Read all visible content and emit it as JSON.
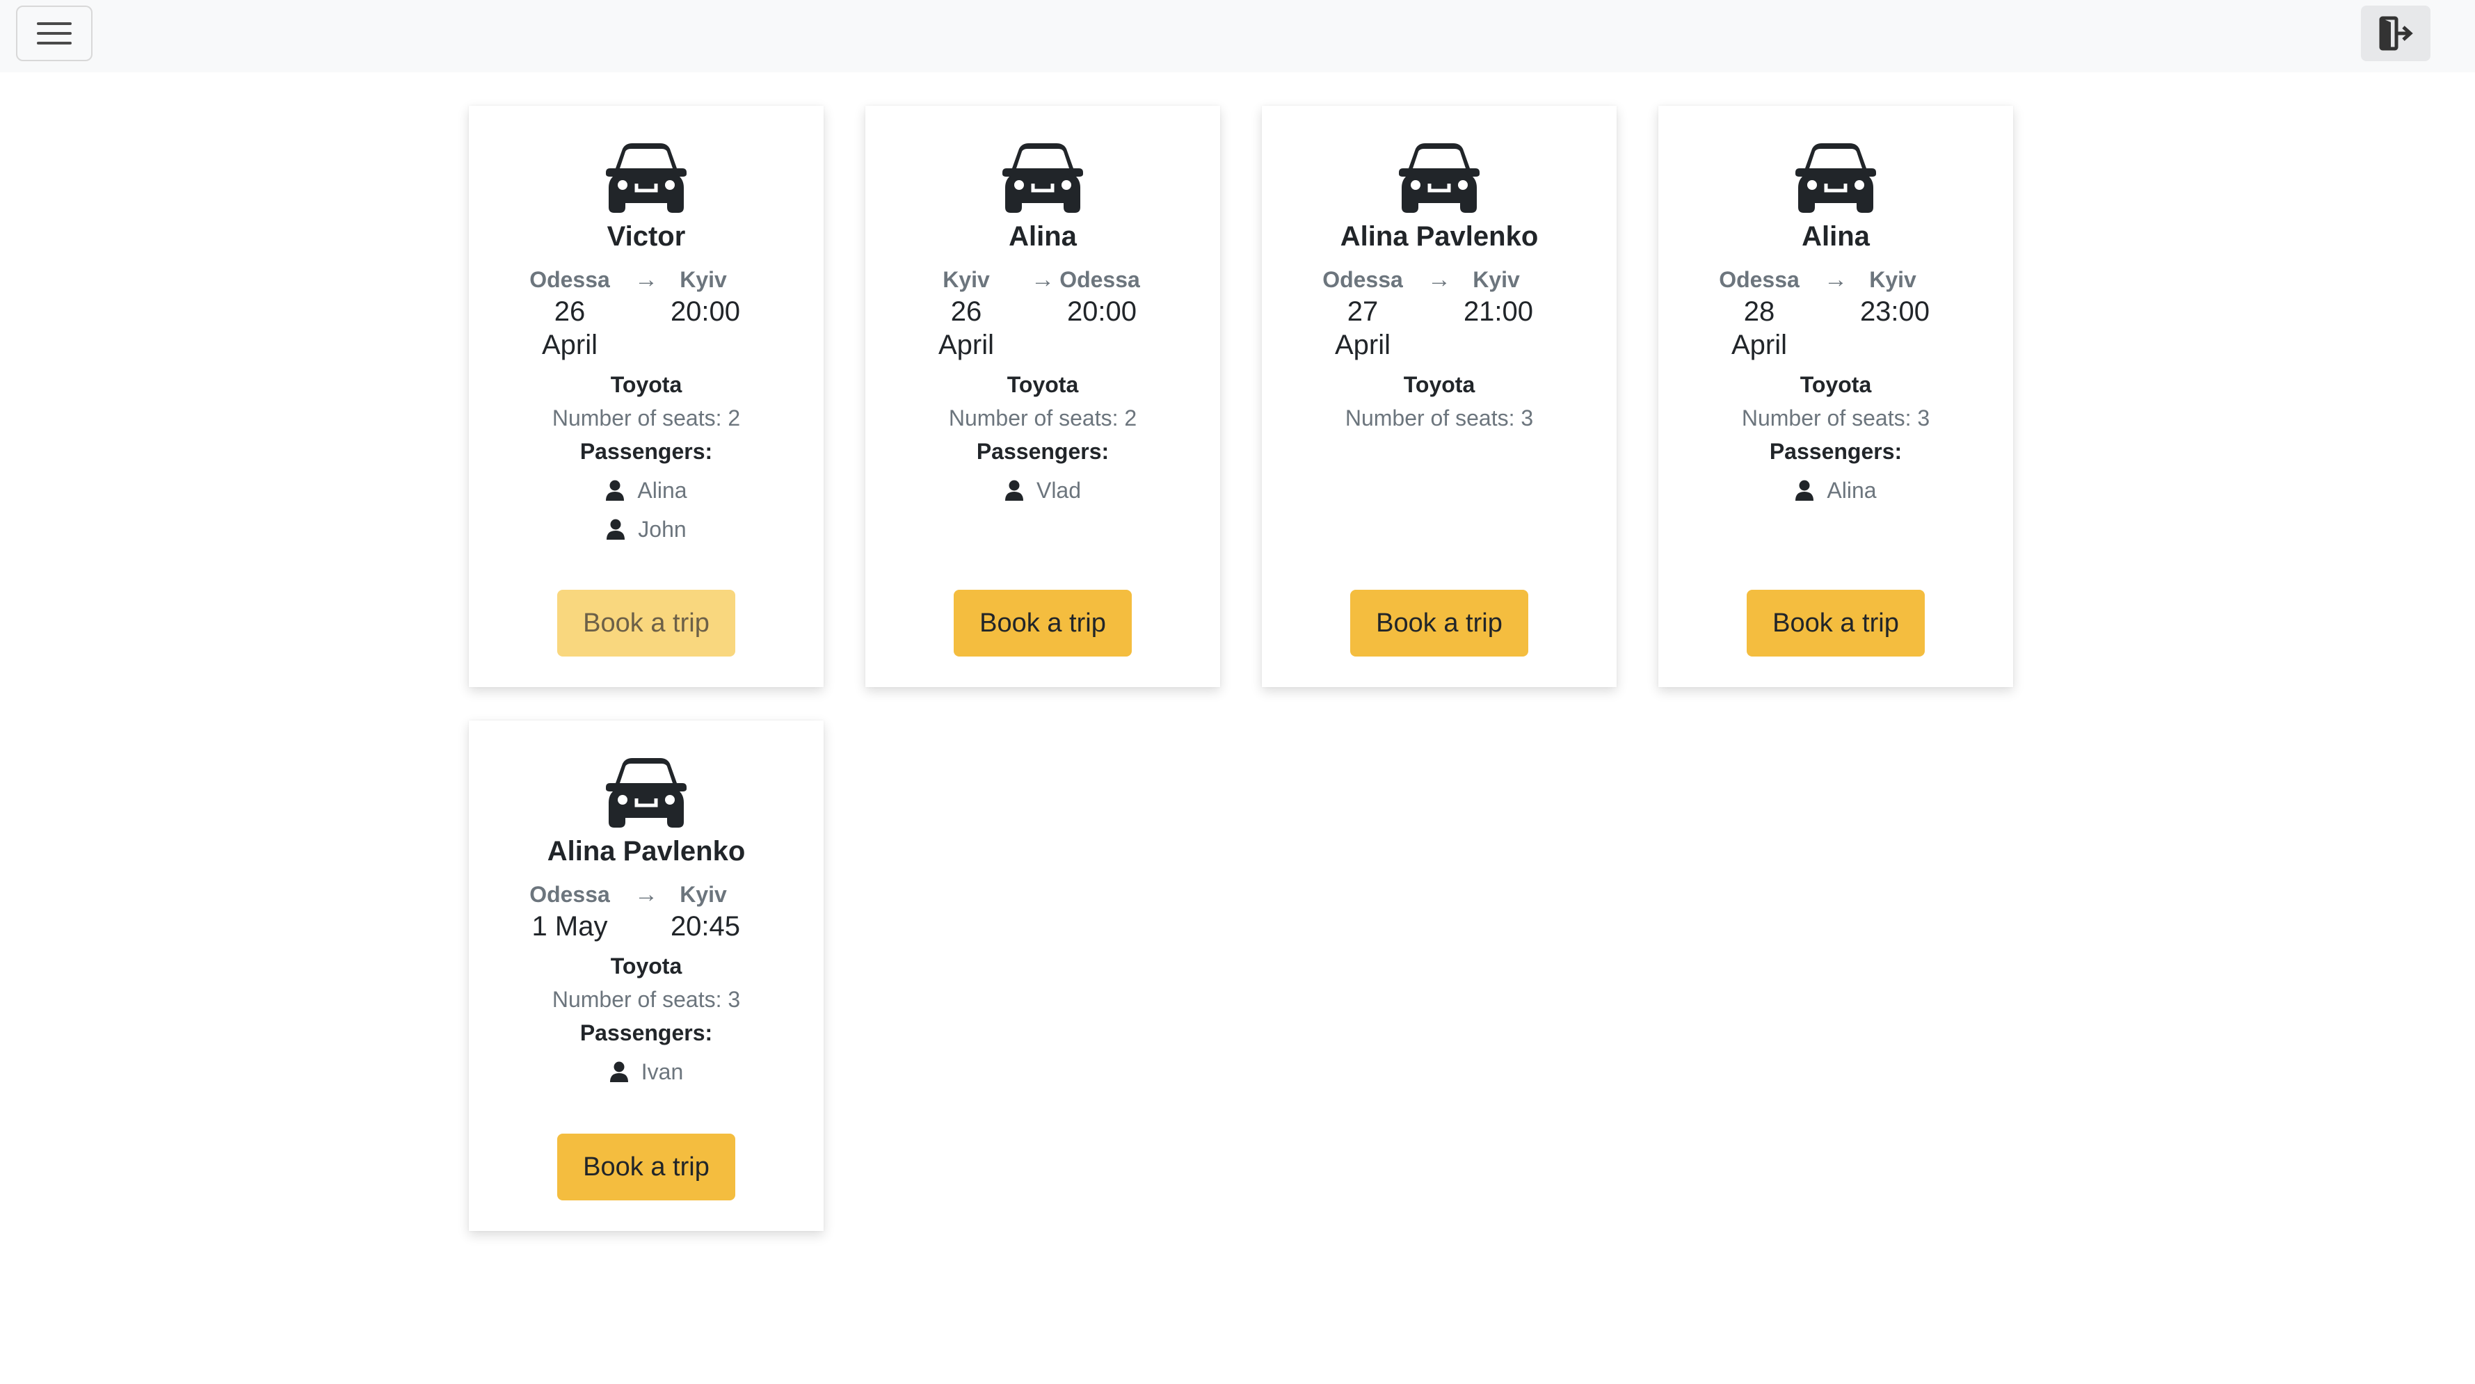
{
  "navbar": {
    "menu_icon": "hamburger-menu-icon",
    "logout_icon": "logout-icon"
  },
  "colors": {
    "accent": "#f4bd3f",
    "accent_disabled": "#f9d77e",
    "muted_text": "#6c757d",
    "navbar_bg": "#f8f9fa"
  },
  "trips": [
    {
      "driver": "Victor",
      "from": "Odessa",
      "to": "Kyiv",
      "arrow": "→",
      "date": "26 April",
      "time": "20:00",
      "car": "Toyota",
      "seats": "Number of seats: 2",
      "passengers_label": "Passengers:",
      "passengers": [
        "Alina",
        "John"
      ],
      "book_label": "Book a trip",
      "book_disabled": true
    },
    {
      "driver": "Alina",
      "from": "Kyiv",
      "to": "Odessa",
      "arrow": "→",
      "date": "26 April",
      "time": "20:00",
      "car": "Toyota",
      "seats": "Number of seats: 2",
      "passengers_label": "Passengers:",
      "passengers": [
        "Vlad"
      ],
      "book_label": "Book a trip",
      "book_disabled": false
    },
    {
      "driver": "Alina Pavlenko",
      "from": "Odessa",
      "to": "Kyiv",
      "arrow": "→",
      "date": "27 April",
      "time": "21:00",
      "car": "Toyota",
      "seats": "Number of seats: 3",
      "passengers_label": "",
      "passengers": [],
      "book_label": "Book a trip",
      "book_disabled": false
    },
    {
      "driver": "Alina",
      "from": "Odessa",
      "to": "Kyiv",
      "arrow": "→",
      "date": "28 April",
      "time": "23:00",
      "car": "Toyota",
      "seats": "Number of seats: 3",
      "passengers_label": "Passengers:",
      "passengers": [
        "Alina"
      ],
      "book_label": "Book a trip",
      "book_disabled": false
    },
    {
      "driver": "Alina Pavlenko",
      "from": "Odessa",
      "to": "Kyiv",
      "arrow": "→",
      "date": "1 May",
      "time": "20:45",
      "car": "Toyota",
      "seats": "Number of seats: 3",
      "passengers_label": "Passengers:",
      "passengers": [
        "Ivan"
      ],
      "book_label": "Book a trip",
      "book_disabled": false
    }
  ]
}
